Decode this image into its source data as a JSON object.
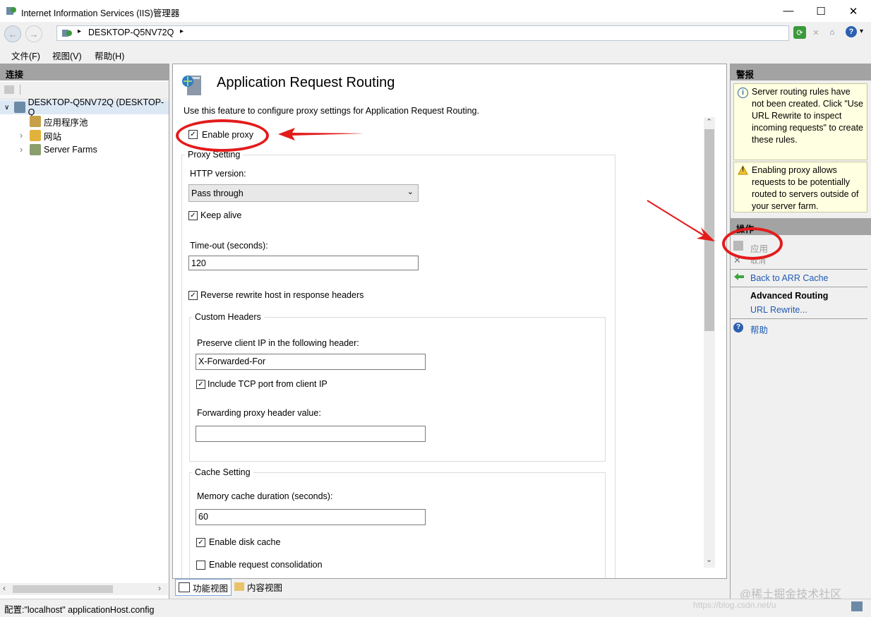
{
  "window": {
    "title": "Internet Information Services (IIS)管理器",
    "minimize": "—",
    "maximize": "☐",
    "close": "✕"
  },
  "address": {
    "back_icon": "back-arrow-icon",
    "forward_icon": "forward-arrow-icon",
    "path": "DESKTOP-Q5NV72Q",
    "separator": "▸",
    "end_arrow": "▸",
    "help_glyph": "?",
    "dropdown_glyph": "▾"
  },
  "menu": [
    "文件(F)",
    "视图(V)",
    "帮助(H)"
  ],
  "connections": {
    "header": "连接",
    "tree": [
      {
        "label": "DESKTOP-Q5NV72Q (DESKTOP-Q",
        "expand": "∨",
        "icon": "server-icon"
      },
      {
        "label": "应用程序池",
        "expand": "",
        "icon": "app-pool-icon"
      },
      {
        "label": "网站",
        "expand": "›",
        "icon": "sites-icon"
      },
      {
        "label": "Server Farms",
        "expand": "›",
        "icon": "server-farms-icon"
      }
    ],
    "scroll_left": "‹",
    "scroll_right": "›"
  },
  "feature": {
    "title": "Application Request Routing",
    "description": "Use this feature to configure proxy settings for Application Request Routing.",
    "enable_proxy": {
      "label": "Enable proxy",
      "checked": true
    },
    "proxy_setting": {
      "group_label": "Proxy Setting",
      "http_version_label": "HTTP version:",
      "http_version_value": "Pass through",
      "keep_alive": {
        "label": "Keep alive",
        "checked": true
      },
      "timeout_label": "Time-out (seconds):",
      "timeout_value": "120",
      "reverse_rewrite": {
        "label": "Reverse rewrite host in response headers",
        "checked": true
      }
    },
    "custom_headers": {
      "group_label": "Custom Headers",
      "preserve_label": "Preserve client IP in the following header:",
      "preserve_value": "X-Forwarded-For",
      "include_tcp": {
        "label": "Include TCP port from client IP",
        "checked": true
      },
      "forwarding_label": "Forwarding proxy header value:",
      "forwarding_value": ""
    },
    "cache_setting": {
      "group_label": "Cache Setting",
      "memory_label": "Memory cache duration (seconds):",
      "memory_value": "60",
      "disk_cache": {
        "label": "Enable disk cache",
        "checked": true
      },
      "request_consolidation": {
        "label": "Enable request consolidation",
        "checked": false
      }
    }
  },
  "view_tabs": [
    {
      "label": "功能视图",
      "active": true
    },
    {
      "label": "内容视图",
      "active": false
    }
  ],
  "scroll": {
    "up": "⌃",
    "down": "⌄"
  },
  "alerts": {
    "header": "警报",
    "items": [
      {
        "icon": "info-icon",
        "glyph": "i",
        "text": "Server routing rules have not been created. Click \"Use URL Rewrite to inspect incoming requests\" to create these rules."
      },
      {
        "icon": "warning-icon",
        "glyph": "!",
        "text": "Enabling proxy allows requests to be potentially routed to servers outside of your server farm."
      }
    ]
  },
  "actions": {
    "header": "操作",
    "apply": "应用",
    "cancel": "取消",
    "back": "Back to ARR Cache",
    "advanced_title": "Advanced Routing",
    "url_rewrite": "URL Rewrite...",
    "help": "帮助",
    "help_glyph": "?"
  },
  "status": {
    "text": "配置:\"localhost\" applicationHost.config",
    "watermark": "@稀土掘金技术社区",
    "watermark_url": "https://blog.csdn.net/u"
  },
  "colors": {
    "accent_link": "#1f5ab3",
    "annotation_red": "#e31b1b",
    "alert_bg": "#ffffe1",
    "panel_header": "#a3a3a3"
  }
}
